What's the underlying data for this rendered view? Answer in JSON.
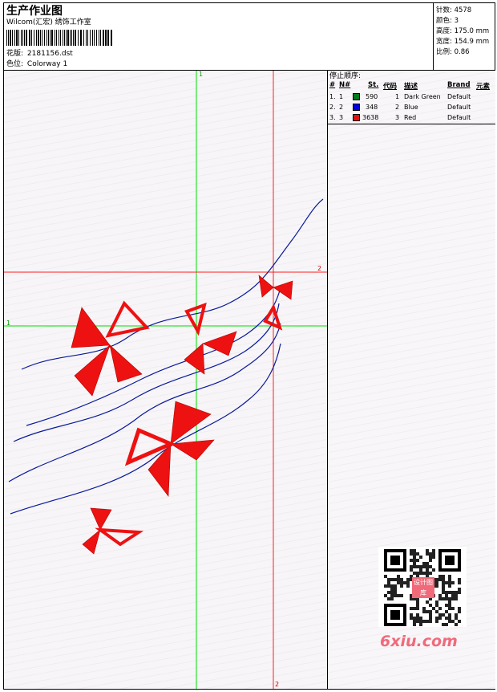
{
  "header": {
    "title": "生产作业图",
    "company": "Wilcom(汇宏) 绣饰工作室",
    "design_label": "花版:",
    "design_file": "2181156.dst",
    "colorway_label": "色位:",
    "colorway": "Colorway 1"
  },
  "stats": [
    {
      "label": "针数:",
      "value": "4578"
    },
    {
      "label": "颜色:",
      "value": "3"
    },
    {
      "label": "高度:",
      "value": "175.0 mm"
    },
    {
      "label": "宽度:",
      "value": "154.9 mm"
    },
    {
      "label": "比例:",
      "value": "0.86"
    }
  ],
  "stop_sequence": {
    "title": "停止顺序:",
    "columns": [
      "#",
      "N#",
      "St.",
      "代码",
      "描述",
      "Brand",
      "元素"
    ],
    "rows": [
      {
        "idx": "1.",
        "n": "1",
        "color": "#007a1f",
        "stitches": "590",
        "code": "1",
        "desc": "Dark Green",
        "brand": "Default"
      },
      {
        "idx": "2.",
        "n": "2",
        "color": "#0000e0",
        "stitches": "348",
        "code": "2",
        "desc": "Blue",
        "brand": "Default"
      },
      {
        "idx": "3.",
        "n": "3",
        "color": "#e01010",
        "stitches": "3638",
        "code": "3",
        "desc": "Red",
        "brand": "Default"
      }
    ]
  },
  "guides": {
    "v1": "1",
    "h1": "1",
    "h2": "2",
    "v2": "2"
  },
  "colors": {
    "green_guide": "#00e000",
    "red_guide": "#ff2020",
    "stitch_blue": "#0a1a9a",
    "stitch_red": "#ee1111"
  },
  "watermark": {
    "text": "6xiu.com",
    "qr_label": "设计图库"
  }
}
